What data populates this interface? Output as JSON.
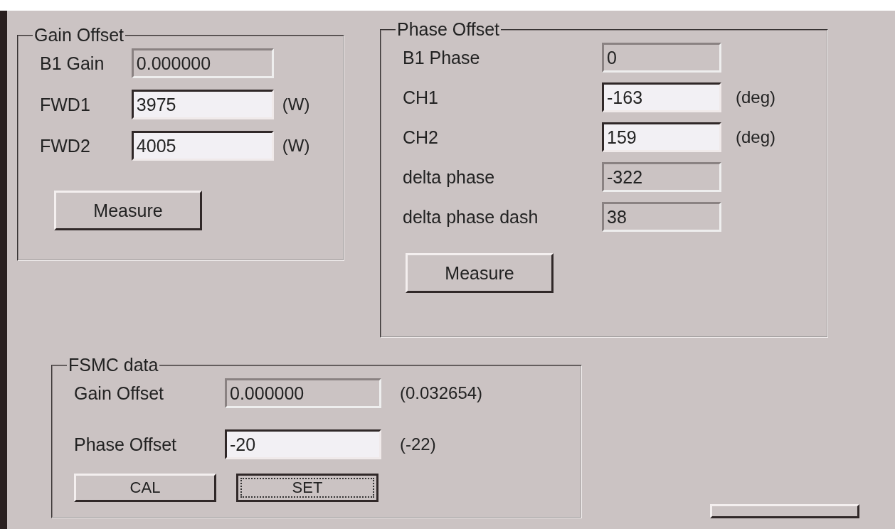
{
  "groups": [
    {
      "title": "Gain Offset",
      "rows": [
        {
          "label": "B1 Gain",
          "value": "0.000000",
          "editable": false
        },
        {
          "label": "FWD1",
          "value": "3975",
          "editable": true,
          "unit": "(W)"
        },
        {
          "label": "FWD2",
          "value": "4005",
          "editable": true,
          "unit": "(W)"
        }
      ],
      "button": "Measure"
    },
    {
      "title": "Phase Offset",
      "rows": [
        {
          "label": "B1 Phase",
          "value": "0",
          "editable": false
        },
        {
          "label": "CH1",
          "value": "-163",
          "editable": true,
          "unit": "(deg)"
        },
        {
          "label": "CH2",
          "value": "159",
          "editable": true,
          "unit": "(deg)"
        },
        {
          "label": "delta phase",
          "value": "-322",
          "editable": false
        },
        {
          "label": "delta phase dash",
          "value": "38",
          "editable": false
        }
      ],
      "button": "Measure"
    },
    {
      "title": "FSMC data",
      "rows": [
        {
          "label": "Gain Offset",
          "value": "0.000000",
          "editable": false,
          "unit": "(0.032654)"
        },
        {
          "label": "Phase Offset",
          "value": "-20",
          "editable": true,
          "unit": "(-22)"
        }
      ],
      "buttons": [
        {
          "label": "CAL",
          "focused": false
        },
        {
          "label": "SET",
          "focused": true
        }
      ]
    }
  ]
}
